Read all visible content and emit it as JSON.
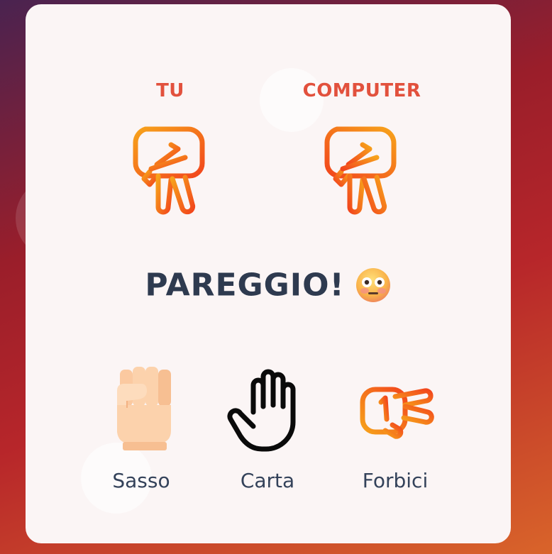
{
  "players": [
    {
      "label": "TU",
      "hand": "scissors-icon"
    },
    {
      "label": "COMPUTER",
      "hand": "scissors-icon"
    }
  ],
  "result": {
    "text": "PAREGGIO!",
    "emoji": "flushed-face-icon"
  },
  "choices": [
    {
      "label": "Sasso",
      "icon": "rock-fist-icon"
    },
    {
      "label": "Carta",
      "icon": "paper-hand-icon"
    },
    {
      "label": "Forbici",
      "icon": "scissors-hand-icon"
    }
  ],
  "colors": {
    "accent": "#e2513d",
    "text_dark": "#2e3a4f",
    "card_background": "#fbf5f5",
    "gradient_orange": "#f7a21b",
    "gradient_red": "#f2461c"
  }
}
